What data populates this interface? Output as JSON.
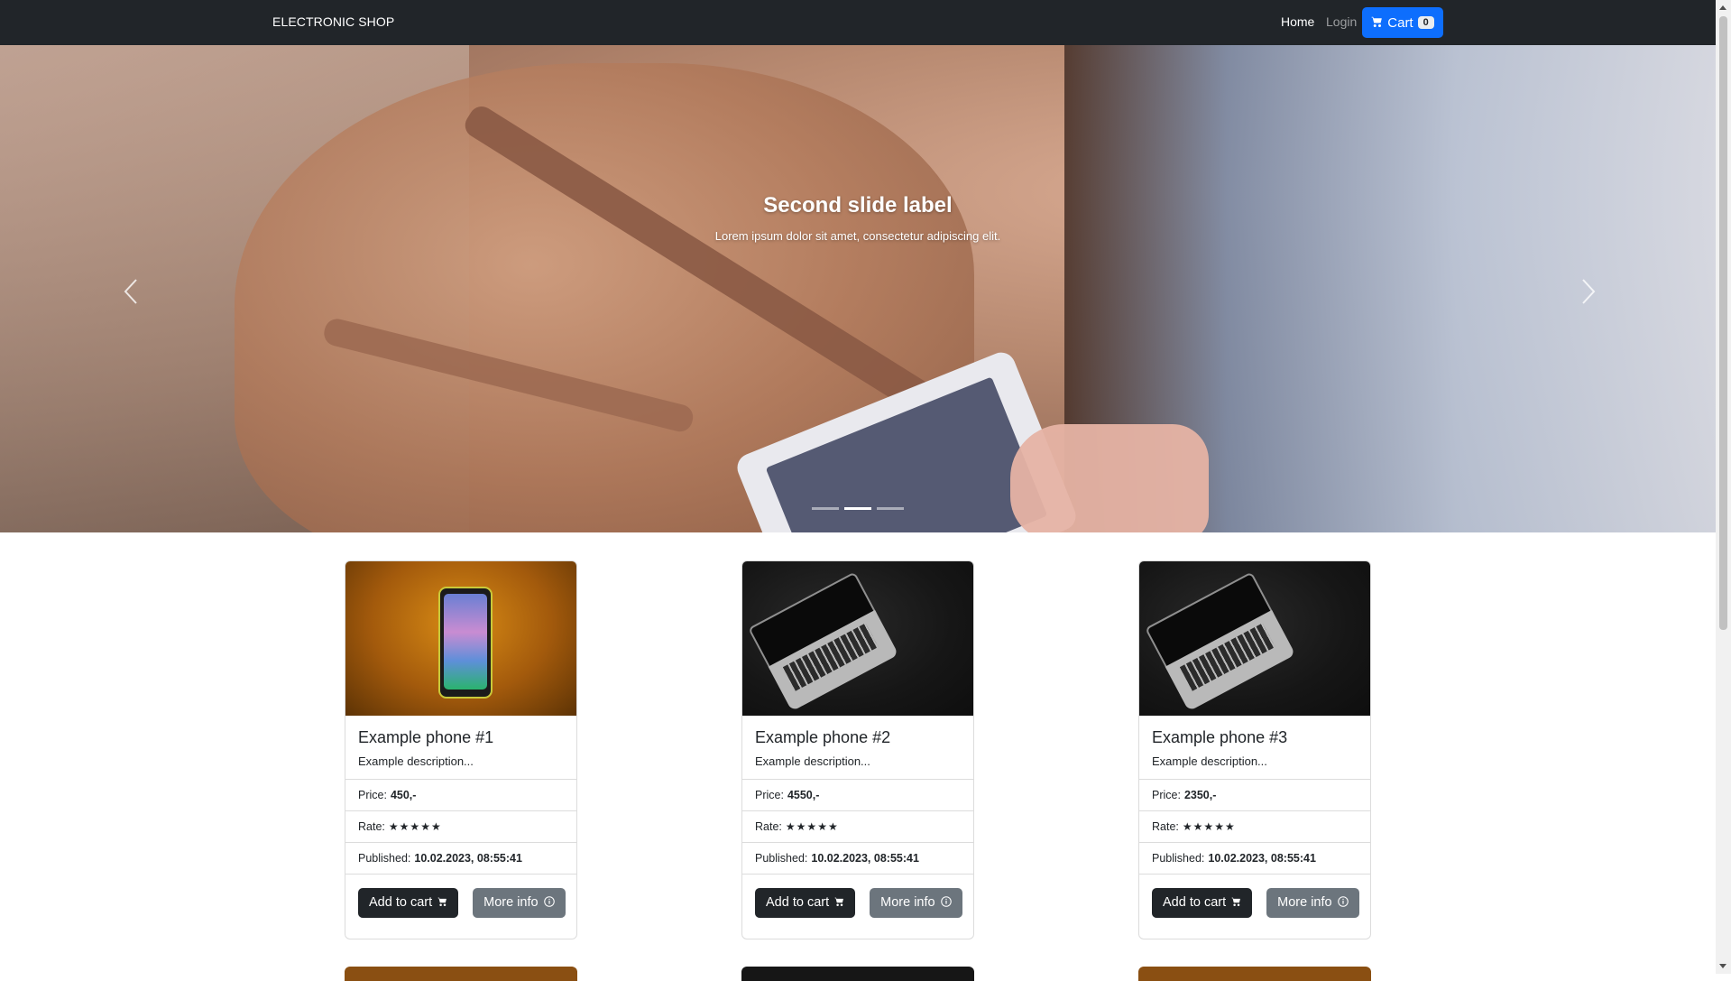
{
  "navbar": {
    "brand": "ELECTRONIC SHOP",
    "home": "Home",
    "login": "Login",
    "cart_label": "Cart",
    "cart_count": "0",
    "cart_icon": "cart-icon",
    "accent_color": "#0d6efd",
    "bg_color": "#212529"
  },
  "carousel": {
    "title": "Second slide label",
    "text": "Lorem ipsum dolor sit amet, consectetur adipiscing elit.",
    "indicator_count": 3,
    "active_indicator": 2,
    "prev_icon": "chevron-left-icon",
    "next_icon": "chevron-right-icon"
  },
  "products": [
    {
      "title": "Example phone #1",
      "description": "Example description...",
      "price_label": "Price:",
      "price": "450,-",
      "rate_label": "Rate:",
      "rating": 5,
      "published_label": "Published:",
      "published": "10.02.2023, 08:55:41",
      "add_to_cart": "Add to cart",
      "more_info": "More info",
      "image": "phone"
    },
    {
      "title": "Example phone #2",
      "description": "Example description...",
      "price_label": "Price:",
      "price": "4550,-",
      "rate_label": "Rate:",
      "rating": 5,
      "published_label": "Published:",
      "published": "10.02.2023, 08:55:41",
      "add_to_cart": "Add to cart",
      "more_info": "More info",
      "image": "laptop"
    },
    {
      "title": "Example phone #3",
      "description": "Example description...",
      "price_label": "Price:",
      "price": "2350,-",
      "rate_label": "Rate:",
      "rating": 5,
      "published_label": "Published:",
      "published": "10.02.2023, 08:55:41",
      "add_to_cart": "Add to cart",
      "more_info": "More info",
      "image": "laptop"
    }
  ],
  "icons": {
    "star": "star-icon",
    "info": "info-icon",
    "cart": "cart-icon"
  }
}
